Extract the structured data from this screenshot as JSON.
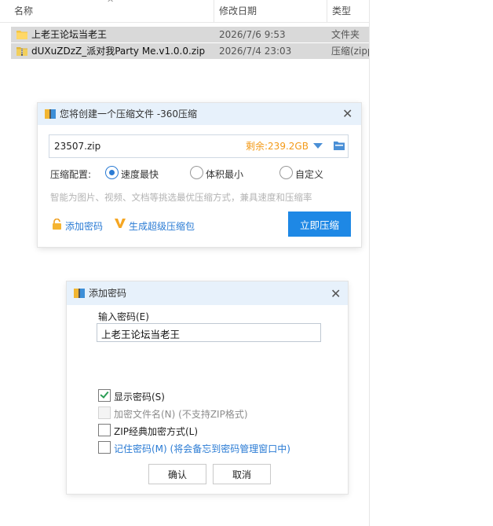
{
  "explorer": {
    "columns": {
      "name": "名称",
      "date": "修改日期",
      "type": "类型"
    },
    "files": [
      {
        "name": "上老王论坛当老王",
        "date": "2026/7/6 9:53",
        "type": "文件夹"
      },
      {
        "name": "dUXuZDzZ_派对我Party Me.v1.0.0.zip",
        "date": "2026/7/4 23:03",
        "type": "压缩(zipped)"
      }
    ]
  },
  "compress_dialog": {
    "title": "您将创建一个压缩文件 -360压缩",
    "filename": "23507.zip",
    "free_space": "剩余:239.2GB",
    "config_label": "压缩配置:",
    "options": [
      "速度最快",
      "体积最小",
      "自定义"
    ],
    "selected_option": "速度最快",
    "hint": "智能为图片、视频、文档等挑选最优压缩方式，兼具速度和压缩率",
    "add_password": "添加密码",
    "super_package": "生成超级压缩包",
    "compress_now": "立即压缩"
  },
  "password_dialog": {
    "title": "添加密码",
    "input_label": "输入密码(E)",
    "password_value": "上老王论坛当老王",
    "checkboxes": [
      {
        "label": "显示密码(S)",
        "checked": true,
        "disabled": false
      },
      {
        "label": "加密文件名(N) (不支持ZIP格式)",
        "checked": false,
        "disabled": true
      },
      {
        "label": "ZIP经典加密方式(L)",
        "checked": false,
        "disabled": false
      },
      {
        "label": "记住密码(M) (将会备忘到密码管理窗口中)",
        "checked": false,
        "disabled": false
      }
    ],
    "ok": "确认",
    "cancel": "取消"
  },
  "colors": {
    "accent": "#1e88e5",
    "free_space": "#f39a18",
    "title_bar": "#e7f1fb",
    "check": "#2a9d55"
  }
}
